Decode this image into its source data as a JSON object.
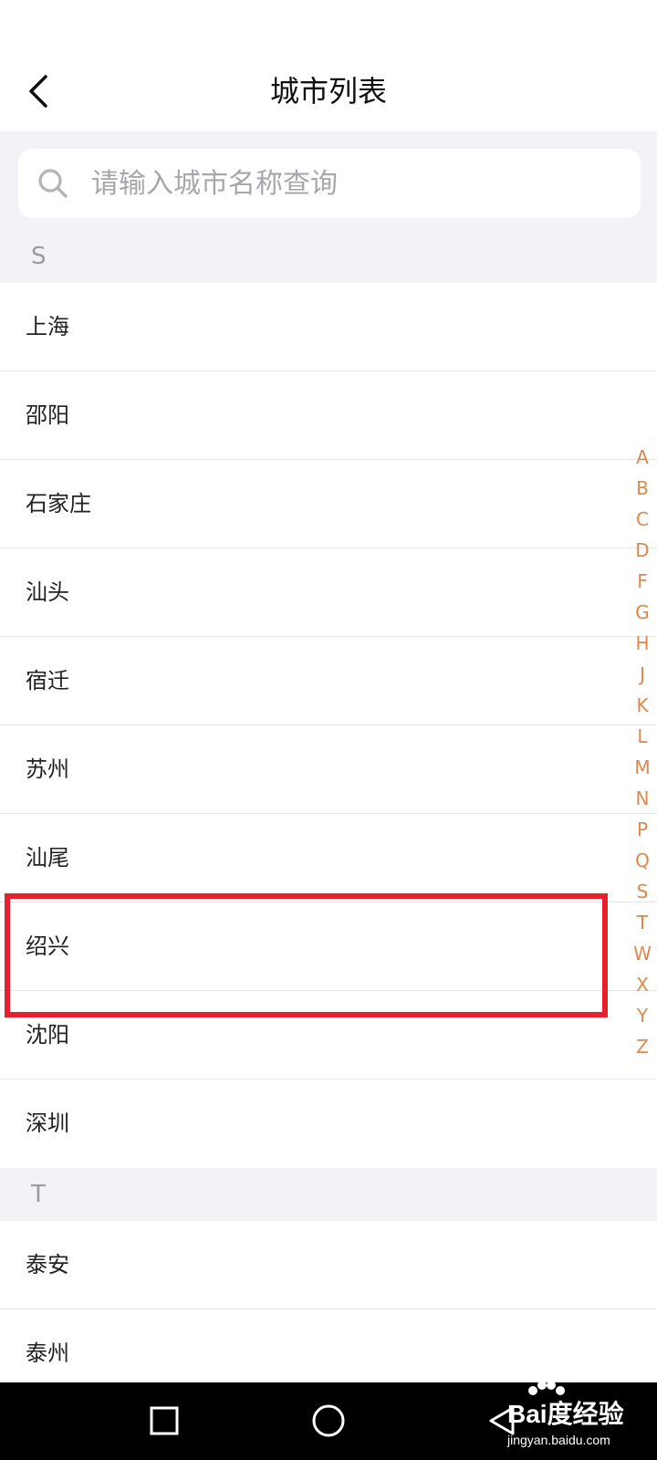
{
  "header": {
    "title": "城市列表",
    "back_icon": "chevron-left-icon"
  },
  "search": {
    "placeholder": "请输入城市名称查询",
    "value": "",
    "icon": "search-icon"
  },
  "sections": [
    {
      "letter": "S",
      "cities": [
        "上海",
        "邵阳",
        "石家庄",
        "汕头",
        "宿迁",
        "苏州",
        "汕尾",
        "绍兴",
        "沈阳",
        "深圳"
      ]
    },
    {
      "letter": "T",
      "cities": [
        "泰安",
        "泰州"
      ]
    }
  ],
  "highlighted_city": "绍兴",
  "alphabet_index": [
    "A",
    "B",
    "C",
    "D",
    "F",
    "G",
    "H",
    "J",
    "K",
    "L",
    "M",
    "N",
    "P",
    "Q",
    "S",
    "T",
    "W",
    "X",
    "Y",
    "Z"
  ],
  "navbar": {
    "recent_icon": "square-icon",
    "home_icon": "circle-icon",
    "back_icon": "triangle-back-icon"
  },
  "watermark": {
    "brand": "Bai度经验",
    "site": "jingyan.baidu.com"
  },
  "colors": {
    "accent_index": "#e0884a",
    "highlight_border": "#e8202c",
    "section_bg": "#f3f3f7"
  }
}
